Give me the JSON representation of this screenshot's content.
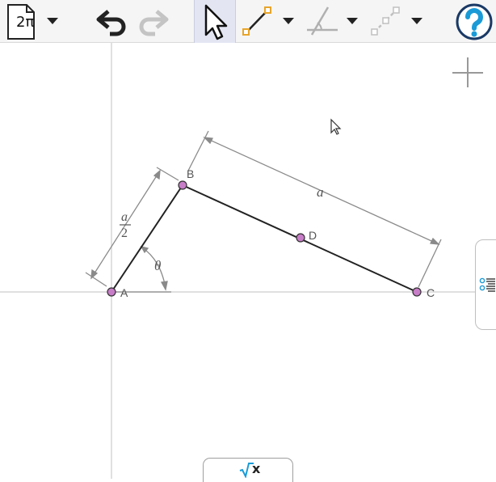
{
  "toolbar": {
    "file_button": {
      "label": "2π",
      "icon": "file-document-icon"
    },
    "undo": {
      "icon": "undo-arrow-icon"
    },
    "redo": {
      "icon": "redo-arrow-icon"
    },
    "move_tool": {
      "icon": "cursor-arrow-icon",
      "active": true
    },
    "line_tool": {
      "icon": "segment-icon"
    },
    "angle_tool": {
      "icon": "angle-icon"
    },
    "transform_tool": {
      "icon": "dashed-segment-icon"
    },
    "help": {
      "icon": "question-mark-icon"
    },
    "colors": {
      "accent": "#1a9bd7",
      "active_bg": "#e3e6f2",
      "point_orange": "#e8a52a"
    }
  },
  "canvas": {
    "points": [
      {
        "name": "A"
      },
      {
        "name": "B"
      },
      {
        "name": "C"
      },
      {
        "name": "D"
      }
    ],
    "labels": {
      "length_a": "a",
      "half_numerator": "a",
      "half_denominator": "2",
      "angle": "θ"
    },
    "colors": {
      "point_fill": "#c77dc7",
      "segment": "#222222",
      "dimension": "#8a8a8a"
    }
  },
  "side_tab": {
    "icon": "algebra-view-icon"
  },
  "input_tab": {
    "label": "x",
    "icon": "square-root-icon"
  }
}
